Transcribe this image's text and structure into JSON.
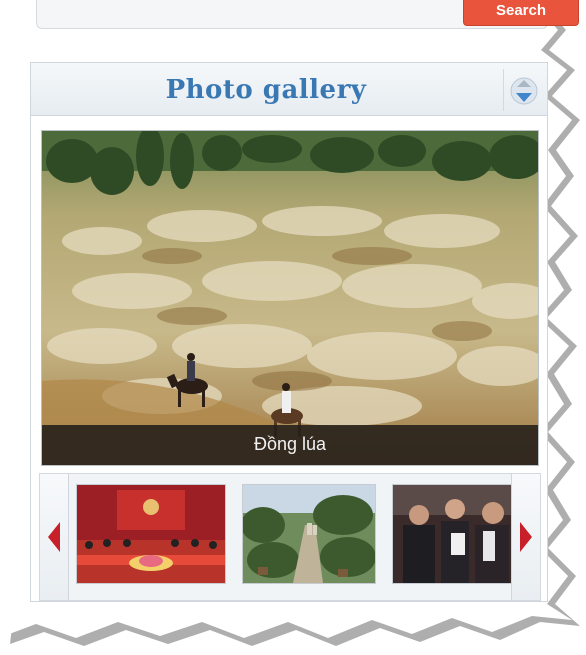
{
  "search": {
    "button_label": "Search"
  },
  "gallery": {
    "title": "Photo gallery",
    "collapse_icon": "chevron-toggle-icon",
    "main_photo": {
      "caption": "Đồng lúa"
    },
    "thumbnails": [
      {
        "name": "conference-meeting-thumbnail"
      },
      {
        "name": "potted-plant-garden-thumbnail"
      },
      {
        "name": "officials-group-thumbnail"
      }
    ],
    "prev_icon": "left-arrow-icon",
    "next_icon": "right-arrow-icon"
  },
  "colors": {
    "accent_title": "#3a78b4",
    "search_button": "#e8553c",
    "arrow": "#c8202a"
  }
}
